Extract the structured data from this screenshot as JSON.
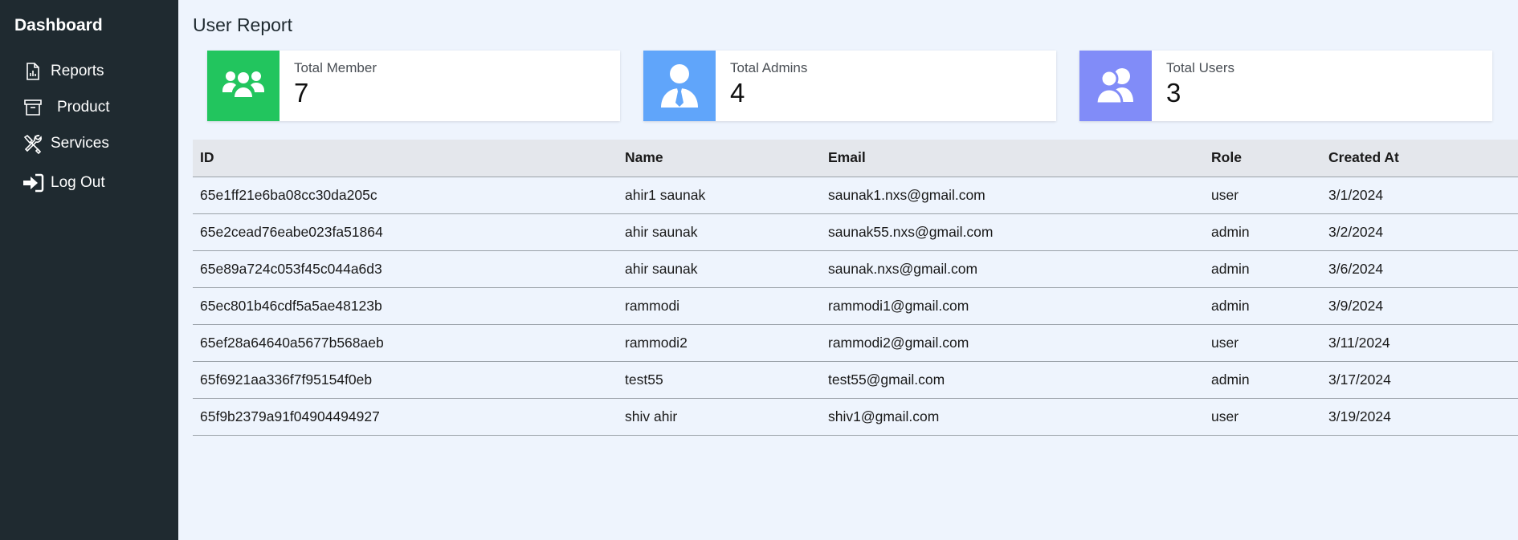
{
  "sidebar": {
    "brand": "Dashboard",
    "items": [
      {
        "label": "Reports",
        "icon": "report-icon"
      },
      {
        "label": "Product",
        "icon": "archive-box-icon"
      },
      {
        "label": "Services",
        "icon": "tools-icon"
      },
      {
        "label": "Log Out",
        "icon": "logout-icon"
      }
    ]
  },
  "main": {
    "title": "User Report",
    "cards": [
      {
        "label": "Total Member",
        "value": "7",
        "color": "#22c55e",
        "icon": "users-group-icon"
      },
      {
        "label": "Total Admins",
        "value": "4",
        "color": "#60a5fa",
        "icon": "admin-person-icon"
      },
      {
        "label": "Total Users",
        "value": "3",
        "color": "#818cf8",
        "icon": "users-icon"
      }
    ],
    "table": {
      "headers": [
        "ID",
        "Name",
        "Email",
        "Role",
        "Created At"
      ],
      "rows": [
        [
          "65e1ff21e6ba08cc30da205c",
          "ahir1 saunak",
          "saunak1.nxs@gmail.com",
          "user",
          "3/1/2024"
        ],
        [
          "65e2cead76eabe023fa51864",
          "ahir saunak",
          "saunak55.nxs@gmail.com",
          "admin",
          "3/2/2024"
        ],
        [
          "65e89a724c053f45c044a6d3",
          "ahir saunak",
          "saunak.nxs@gmail.com",
          "admin",
          "3/6/2024"
        ],
        [
          "65ec801b46cdf5a5ae48123b",
          "rammodi",
          "rammodi1@gmail.com",
          "admin",
          "3/9/2024"
        ],
        [
          "65ef28a64640a5677b568aeb",
          "rammodi2",
          "rammodi2@gmail.com",
          "user",
          "3/11/2024"
        ],
        [
          "65f6921aa336f7f95154f0eb",
          "test55",
          "test55@gmail.com",
          "admin",
          "3/17/2024"
        ],
        [
          "65f9b2379a91f04904494927",
          "shiv ahir",
          "shiv1@gmail.com",
          "user",
          "3/19/2024"
        ]
      ]
    }
  },
  "colors": {
    "sidebar_bg": "#1f2a30",
    "page_bg": "#eef4fd",
    "table_header_bg": "#e4e7ec"
  }
}
